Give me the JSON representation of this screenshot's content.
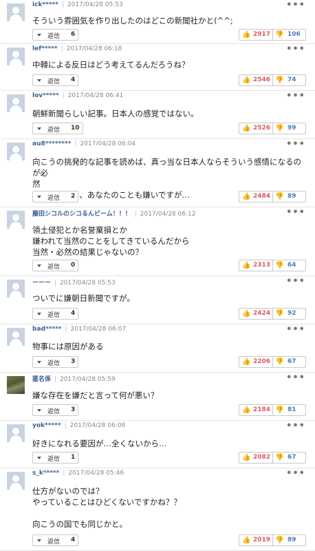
{
  "ui": {
    "reply_label": "返信",
    "more_symbol": "•••",
    "good_symbol": "👍",
    "bad_symbol": "👎"
  },
  "comments": [
    {
      "user": "ick*****",
      "date": "2017/04/28 05:53",
      "text": "そういう雰囲気を作り出したのはどこの新聞社かと(^^;",
      "replies": "6",
      "good": "2917",
      "bad": "106",
      "avatar": "default"
    },
    {
      "user": "lef*****",
      "date": "2017/04/28 06:18",
      "text": "中韓による反日はどう考えてるんだろうね？",
      "replies": "4",
      "good": "2546",
      "bad": "74",
      "avatar": "default"
    },
    {
      "user": "lov*****",
      "date": "2017/04/28 06:41",
      "text": "朝鮮新聞らしい記事。日本人の感覚ではない。",
      "replies": "10",
      "good": "2526",
      "bad": "99",
      "avatar": "default"
    },
    {
      "user": "au8********",
      "date": "2017/04/28 06:04",
      "text": "向こうの挑発的な記事を読めば、真っ当な日本人ならそういう感情になるのが必\n然\n付け加えると、あなたのことも嫌いですが…",
      "replies": "2",
      "good": "2484",
      "bad": "89",
      "avatar": "default"
    },
    {
      "user": "藤田シコルのシコるんビーム！！！",
      "date": "2017/04/28 06:12",
      "text": "領土侵犯とか名誉棄損とか\n嫌われて当然のことをしてきているんだから\n当然・必然の結果じゃないの？",
      "replies": "0",
      "good": "2313",
      "bad": "64",
      "avatar": "default"
    },
    {
      "user": "ーーー",
      "date": "2017/04/28 05:53",
      "text": "ついでに嫌朝日新聞ですが。",
      "replies": "4",
      "good": "2424",
      "bad": "92",
      "avatar": "default"
    },
    {
      "user": "bad*****",
      "date": "2017/04/28 06:07",
      "text": "物事には原因がある",
      "replies": "3",
      "good": "2206",
      "bad": "67",
      "avatar": "default"
    },
    {
      "user": "匿名係",
      "date": "2017/04/28 05:59",
      "text": "嫌な存在を嫌だと言って何が悪い？",
      "replies": "3",
      "good": "2184",
      "bad": "81",
      "avatar": "photo"
    },
    {
      "user": "yok*****",
      "date": "2017/04/28 06:08",
      "text": "好きになれる要因が…全くないから…",
      "replies": "1",
      "good": "2082",
      "bad": "67",
      "avatar": "default"
    },
    {
      "user": "s_k*****",
      "date": "2017/04/28 05:46",
      "text": "仕方がないのでは？\nやっていることはひどくないですかね？？\n\n向こうの国でも同じかと。",
      "replies": "4",
      "good": "2019",
      "bad": "89",
      "avatar": "default"
    }
  ]
}
